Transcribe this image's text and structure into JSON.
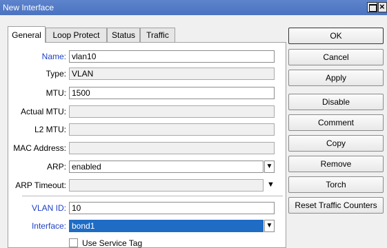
{
  "window": {
    "title": "New Interface"
  },
  "tabs": [
    {
      "label": "General"
    },
    {
      "label": "Loop Protect"
    },
    {
      "label": "Status"
    },
    {
      "label": "Traffic"
    }
  ],
  "form": {
    "name": {
      "label": "Name:",
      "value": "vlan10"
    },
    "type": {
      "label": "Type:",
      "value": "VLAN"
    },
    "mtu": {
      "label": "MTU:",
      "value": "1500"
    },
    "actual_mtu": {
      "label": "Actual MTU:",
      "value": ""
    },
    "l2_mtu": {
      "label": "L2 MTU:",
      "value": ""
    },
    "mac_address": {
      "label": "MAC Address:",
      "value": ""
    },
    "arp": {
      "label": "ARP:",
      "value": "enabled"
    },
    "arp_timeout": {
      "label": "ARP Timeout:",
      "value": ""
    },
    "vlan_id": {
      "label": "VLAN ID:",
      "value": "10"
    },
    "interface": {
      "label": "Interface:",
      "value": "bond1"
    },
    "use_service_tag": {
      "label": "Use Service Tag",
      "checked": false
    }
  },
  "buttons": {
    "ok": "OK",
    "cancel": "Cancel",
    "apply": "Apply",
    "disable": "Disable",
    "comment": "Comment",
    "copy": "Copy",
    "remove": "Remove",
    "torch": "Torch",
    "reset_traffic_counters": "Reset Traffic Counters"
  },
  "colors": {
    "title_bar": "#4a72c0",
    "label_blue": "#1c3fc7",
    "selection": "#1e6cc4"
  }
}
